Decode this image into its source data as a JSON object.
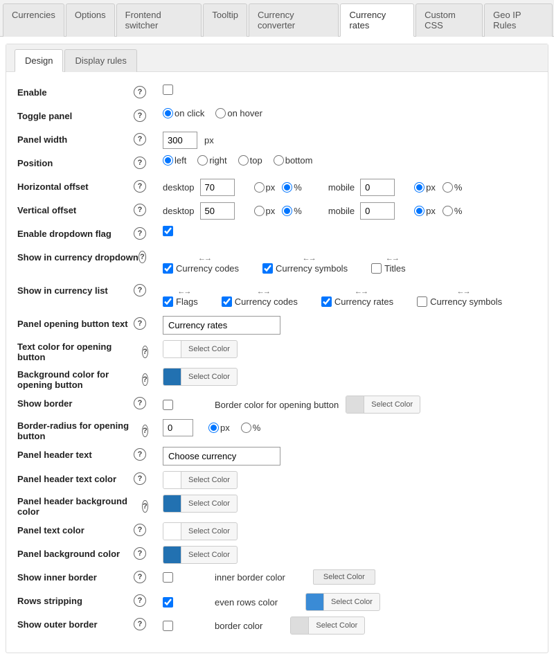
{
  "topTabs": [
    "Currencies",
    "Options",
    "Frontend switcher",
    "Tooltip",
    "Currency converter",
    "Currency rates",
    "Custom CSS",
    "Geo IP Rules"
  ],
  "activeTopTab": 5,
  "subTabs": [
    "Design",
    "Display rules"
  ],
  "activeSubTab": 0,
  "labels": {
    "enable": "Enable",
    "togglePanel": "Toggle panel",
    "panelWidth": "Panel width",
    "position": "Position",
    "hOffset": "Horizontal offset",
    "vOffset": "Vertical offset",
    "enableDropdownFlag": "Enable dropdown flag",
    "showInDropdown": "Show in currency dropdown",
    "showInList": "Show in currency list",
    "panelOpenBtnText": "Panel opening button text",
    "textColorOpenBtn": "Text color for opening button",
    "bgColorOpenBtn": "Background color for opening button",
    "showBorder": "Show border",
    "borderColorOpenBtn": "Border color for opening button",
    "borderRadiusOpenBtn": "Border-radius for opening button",
    "panelHeaderText": "Panel header text",
    "panelHeaderTextColor": "Panel header text color",
    "panelHeaderBgColor": "Panel header background color",
    "panelTextColor": "Panel text color",
    "panelBgColor": "Panel background color",
    "showInnerBorder": "Show inner border",
    "innerBorderColor": "inner border color",
    "rowsStripping": "Rows stripping",
    "evenRowsColor": "even rows color",
    "showOuterBorder": "Show outer border",
    "borderColor": "border color"
  },
  "radios": {
    "onClick": "on click",
    "onHover": "on hover",
    "left": "left",
    "right": "right",
    "top": "top",
    "bottom": "bottom",
    "px": "px",
    "pct": "%",
    "desktop": "desktop",
    "mobile": "mobile"
  },
  "dropdownFields": {
    "codes": "Currency codes",
    "symbols": "Currency symbols",
    "titles": "Titles"
  },
  "listFields": {
    "flags": "Flags",
    "codes": "Currency codes",
    "rates": "Currency rates",
    "symbols": "Currency symbols"
  },
  "values": {
    "panelWidth": "300",
    "hOffsetDesktop": "70",
    "hOffsetMobile": "0",
    "vOffsetDesktop": "50",
    "vOffsetMobile": "0",
    "panelOpenBtnText": "Currency rates",
    "borderRadius": "0",
    "panelHeaderText": "Choose currency"
  },
  "btn": {
    "selectColor": "Select Color"
  },
  "units": {
    "px": "px"
  }
}
